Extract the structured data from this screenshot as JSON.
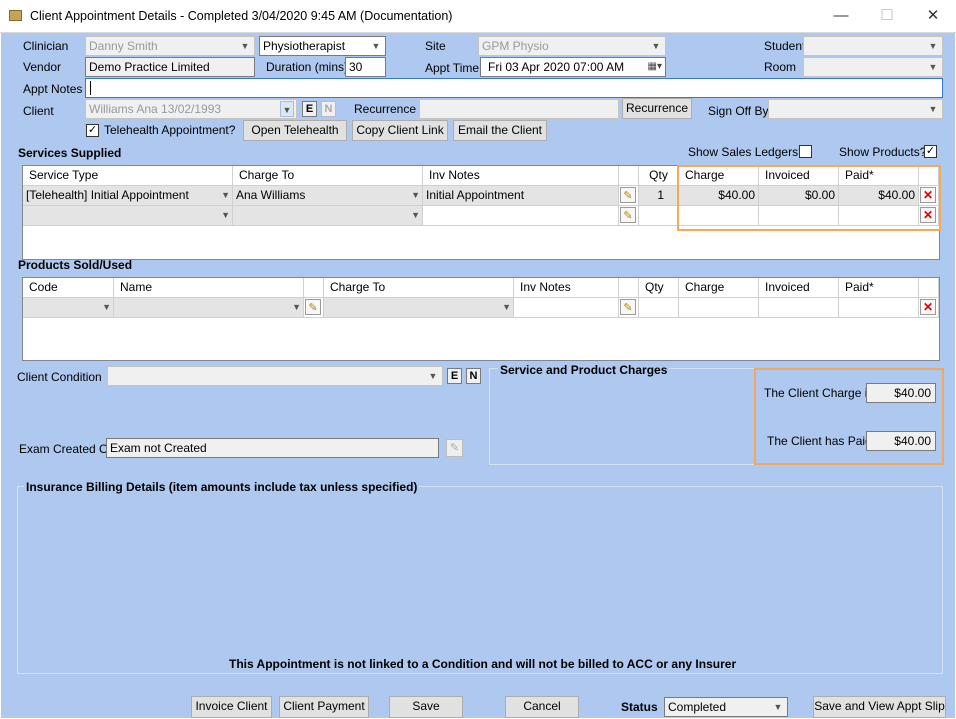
{
  "window": {
    "title": "Client Appointment Details - Completed 3/04/2020 9:45 AM (Documentation)",
    "minimize": "—",
    "maximize": "☐",
    "close": "✕"
  },
  "labels": {
    "clinician": "Clinician",
    "vendor": "Vendor",
    "appt_notes": "Appt Notes",
    "client": "Client",
    "duration": "Duration (mins)",
    "site": "Site",
    "appt_time": "Appt Time",
    "recurrence": "Recurrence",
    "student": "Student",
    "room": "Room",
    "sign_off_by": "Sign Off By"
  },
  "fields": {
    "clinician": "Danny Smith",
    "profession": "Physiotherapist",
    "vendor": "Demo Practice Limited",
    "duration": "30",
    "site": "GPM Physio",
    "appt_time": "Fri  03  Apr  2020 07:00 AM",
    "appt_notes": "",
    "client": "Williams Ana 13/02/1993",
    "recurrence": "",
    "student": "",
    "room": "",
    "sign_off_by": ""
  },
  "client_buttons": {
    "e": "E",
    "n": "N"
  },
  "telehealth": {
    "label": "Telehealth Appointment?",
    "checked": "✓"
  },
  "buttons": {
    "recurrence": "Recurrence",
    "open_telehealth": "Open Telehealth",
    "copy_client_link": "Copy Client Link",
    "email_client": "Email the Client",
    "invoice_client": "Invoice Client",
    "client_payment": "Client Payment",
    "save": "Save",
    "cancel": "Cancel",
    "save_view": "Save and View Appt Slip"
  },
  "services": {
    "title": "Services Supplied",
    "show_sales_ledgers": "Show Sales Ledgers?",
    "show_products": "Show Products?",
    "show_products_checked": "✓",
    "headers": [
      "Service Type",
      "Charge To",
      "Inv Notes",
      "",
      "Qty",
      "Charge",
      "Invoiced",
      "Paid*",
      ""
    ],
    "rows": [
      {
        "service_type": "[Telehealth] Initial Appointment",
        "charge_to": "Ana Williams",
        "inv_notes": "Initial Appointment",
        "qty": "1",
        "charge": "$40.00",
        "invoiced": "$0.00",
        "paid": "$40.00"
      }
    ]
  },
  "products": {
    "title": "Products Sold/Used",
    "headers": [
      "Code",
      "Name",
      "",
      "Charge To",
      "Inv Notes",
      "",
      "Qty",
      "Charge",
      "Invoiced",
      "Paid*",
      ""
    ]
  },
  "condition": {
    "label": "Client Condition",
    "value": "",
    "e": "E",
    "n": "N",
    "exam_label": "Exam Created On",
    "exam_value": "Exam not Created"
  },
  "charges": {
    "title": "Service and Product Charges",
    "client_charge_label": "The Client Charge is",
    "client_charge": "$40.00",
    "client_paid_label": "The Client has Paid",
    "client_paid": "$40.00"
  },
  "insurance": {
    "title": "Insurance Billing Details (item amounts include tax unless specified)",
    "note": "This Appointment is not linked to a Condition and will not be billed to ACC or any Insurer"
  },
  "status": {
    "label": "Status",
    "value": "Completed"
  },
  "icons": {
    "dropdown": "chevron-down-icon",
    "pencil": "pencil-icon",
    "delete": "delete-x-icon",
    "calendar": "calendar-icon"
  }
}
